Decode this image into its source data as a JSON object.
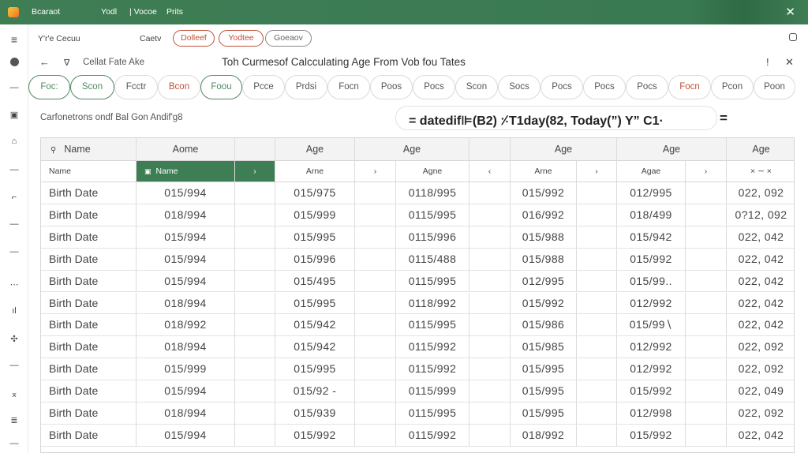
{
  "titlebar": {
    "app_name": "Bcaraot",
    "menu": [
      "Yodl",
      "| Vocoe",
      "Prits"
    ],
    "close_label": "✕"
  },
  "left_rail": {
    "icons": [
      "menu-icon",
      "circle-icon",
      "dash-icon",
      "sheet-icon",
      "folder-icon",
      "dash-icon",
      "corner-icon",
      "dash-icon",
      "dash-icon",
      "dots-icon",
      "chart-icon",
      "move-icon",
      "dash-icon",
      "sort-icon",
      "list-icon"
    ]
  },
  "ribbon": {
    "menu_glyph": "≡",
    "left_text": "Y'r'e Cecuu",
    "label": "Caetv",
    "pill1": "Dolleef",
    "pill2": "Yodtee",
    "pill3": "Goeaov"
  },
  "subbar": {
    "back": "←",
    "filter_glyph": "∇",
    "breadcrumb": "Cellat Fate Ake",
    "title": "Toh Curmesof Calcculating Age From Vob fou Tates",
    "alert": "!",
    "close": "✕"
  },
  "tabs": [
    "Foc:",
    "Scon",
    "Fcctr",
    "Bcon",
    "Foou",
    "Pcce",
    "Prdsi",
    "Focn",
    "Poos",
    "Pocs",
    "Scon",
    "Socs",
    "Pocs",
    "Pocs",
    "Pocs",
    "Focn",
    "Pcon",
    "Poon"
  ],
  "formula": {
    "label": "Carfonetrons ondf Bal Gon Andif'g8",
    "text": "= datedif⊫(B2) ⸓T1day(82, Today(”)   Y”    C1·",
    "trailing": "="
  },
  "grid": {
    "header": [
      "Name",
      "Aome",
      "",
      "Age",
      "Age",
      "",
      "Age",
      "Age",
      "Age"
    ],
    "subheader": [
      "Name",
      "Name",
      "›",
      "Arne",
      "›",
      "Agne",
      "‹",
      "Arne",
      "›",
      "Agae",
      "›",
      "×  ∼  ×"
    ],
    "rows": [
      [
        "Birth Date",
        "015/994",
        "015/975",
        "0118/995",
        "015/992",
        "012/995",
        "022, 092"
      ],
      [
        "Birth Date",
        "018/994",
        "015/999",
        "0115/995",
        "016/992",
        "018/499",
        "0?12, 092"
      ],
      [
        "Birth Date",
        "015/994",
        "015/995",
        "0115/996",
        "015/988",
        "015/942",
        "022, 042"
      ],
      [
        "Birth Date",
        "015/994",
        "015/996",
        "0115/488",
        "015/988",
        "015/992",
        "022, 042"
      ],
      [
        "Birth Date",
        "015/994",
        "015/495",
        "0115/995",
        "012/995",
        "015/99..",
        "022, 042"
      ],
      [
        "Birth Date",
        "018/994",
        "015/995",
        "0118/992",
        "015/992",
        "012/992",
        "022, 042"
      ],
      [
        "Birth Date",
        "018/992",
        "015/942",
        "0115/995",
        "015/986",
        "015/99∖",
        "022, 042"
      ],
      [
        "Birth Date",
        "018/994",
        "015/942",
        "0115/992",
        "015/985",
        "012/992",
        "022, 092"
      ],
      [
        "Birth Date",
        "015/999",
        "015/995",
        "0115/992",
        "015/995",
        "012/992",
        "022, 092"
      ],
      [
        "Birth Date",
        "015/994",
        "015/92 -",
        "0115/999",
        "015/995",
        "015/992",
        "022, 049"
      ],
      [
        "Birth Date",
        "018/994",
        "015/939",
        "0115/995",
        "015/995",
        "012/998",
        "022, 092"
      ],
      [
        "Birth Date",
        "015/994",
        "015/992",
        "0115/992",
        "018/992",
        "015/992",
        "022, 042"
      ]
    ]
  },
  "colors": {
    "accent_green": "#3e7e55",
    "tab_red": "#c0513a"
  }
}
